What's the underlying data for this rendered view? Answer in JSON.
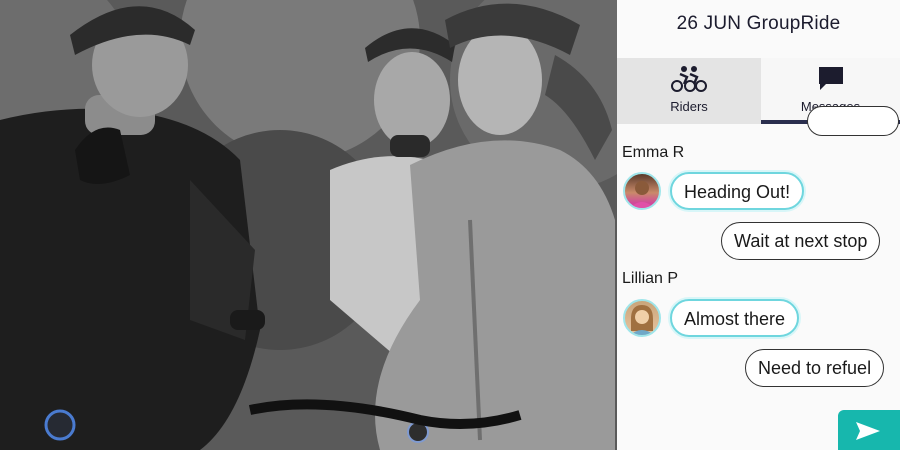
{
  "photo": {
    "subject": "cyclists-photo"
  },
  "app": {
    "title": "26 JUN GroupRide",
    "tabs": [
      {
        "label": "Riders",
        "icon": "cyclists-icon",
        "active": false
      },
      {
        "label": "Messages",
        "icon": "chat-bubble-icon",
        "active": true
      }
    ],
    "messages": [
      {
        "sender": "Emma R",
        "text": "Heading Out!",
        "direction": "incoming"
      },
      {
        "text": "Wait at next stop",
        "direction": "outgoing"
      },
      {
        "sender": "Lillian P",
        "text": "Almost there",
        "direction": "incoming"
      },
      {
        "text": "Need to refuel",
        "direction": "outgoing"
      }
    ],
    "send_icon": "send-arrow-icon"
  },
  "colors": {
    "accent": "#17b7ad",
    "bubble_outline": "#6fd6de",
    "nav_indicator": "#2a2e4e"
  }
}
